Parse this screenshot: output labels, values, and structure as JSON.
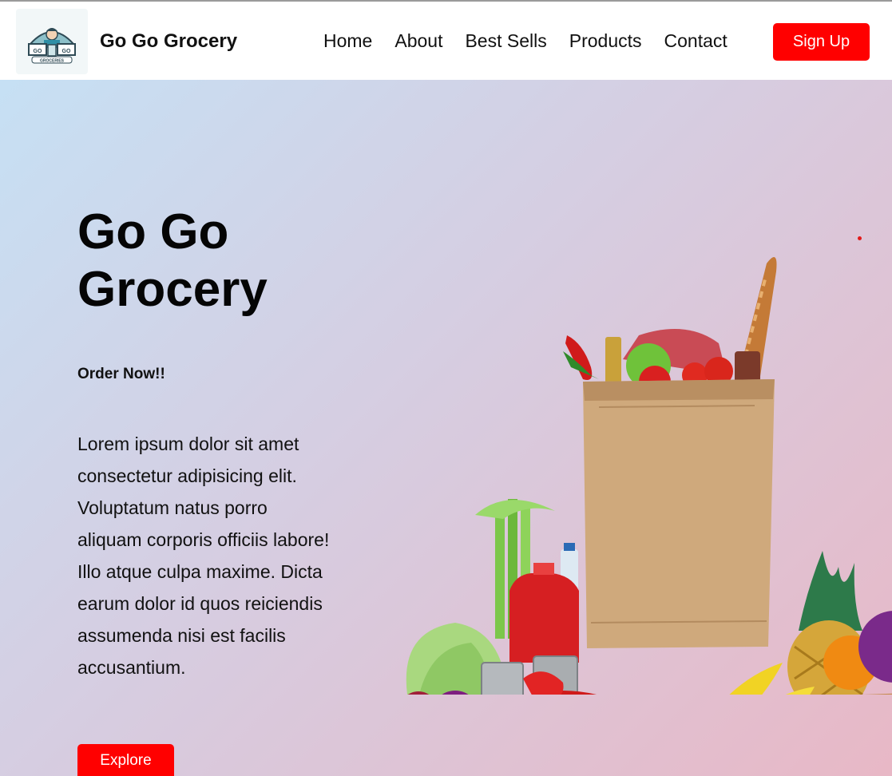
{
  "header": {
    "brand_name": "Go Go Grocery",
    "logo_text": "GROCERIES",
    "nav": [
      "Home",
      "About",
      "Best Sells",
      "Products",
      "Contact"
    ],
    "signup_label": "Sign Up"
  },
  "hero": {
    "title": "Go Go Grocery",
    "subtitle": "Order Now!!",
    "description": "Lorem ipsum dolor sit amet consectetur adipisicing elit. Voluptatum natus porro aliquam corporis officiis labore! Illo atque culpa maxime. Dicta earum dolor id quos reiciendis assumenda nisi est facilis accusantium.",
    "explore_label": "Explore",
    "image_icon": "grocery-bag-illustration"
  },
  "colors": {
    "accent": "#ff0000",
    "gradient_start": "#c6e0f4",
    "gradient_end": "#e8b8c6"
  }
}
